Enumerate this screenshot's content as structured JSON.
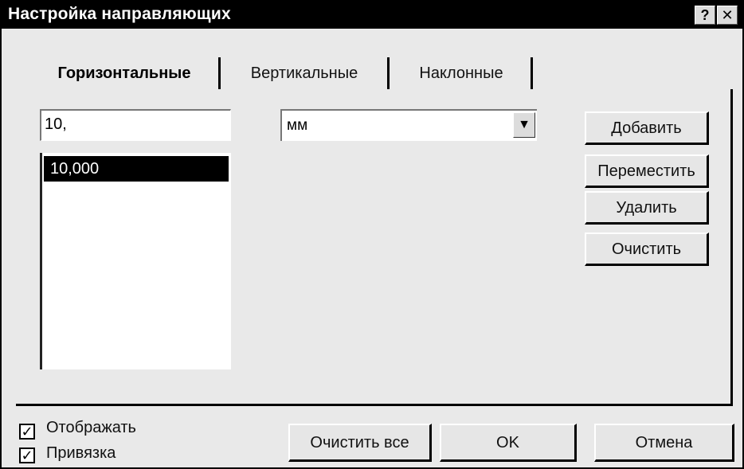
{
  "window": {
    "title": "Настройка направляющих",
    "help_symbol": "?",
    "close_symbol": "✕"
  },
  "tabs": [
    {
      "label": "Горизонтальные",
      "active": true
    },
    {
      "label": "Вертикальные",
      "active": false
    },
    {
      "label": "Наклонные",
      "active": false
    }
  ],
  "value_input": {
    "value": "10,"
  },
  "units_select": {
    "selected": "мм"
  },
  "guides_list": {
    "items": [
      "10,000"
    ]
  },
  "side_buttons": {
    "add": "Добавить",
    "move": "Переместить",
    "delete": "Удалить",
    "clear": "Очистить"
  },
  "checkboxes": {
    "show": {
      "label": "Отображать",
      "checked": true
    },
    "snap": {
      "label": "Привязка",
      "checked": true
    }
  },
  "footer_buttons": {
    "clear_all": "Очистить все",
    "ok": "OK",
    "cancel": "Отмена"
  },
  "colors": {
    "titlebar": "#000000",
    "dialog_bg": "#e9e9e9",
    "selection": "#000000"
  }
}
